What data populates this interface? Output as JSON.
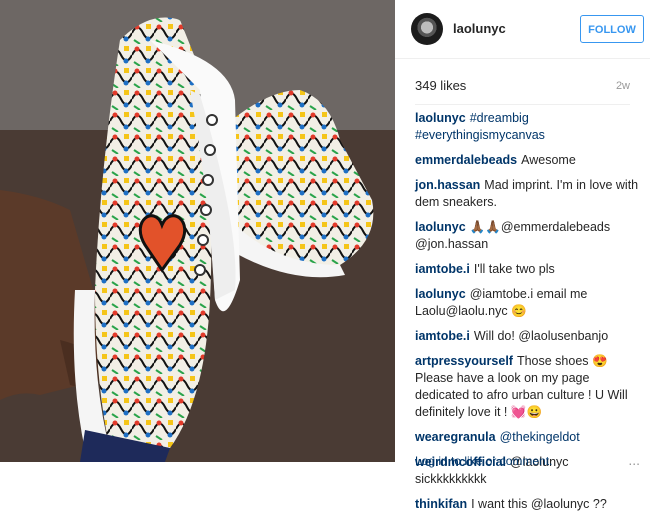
{
  "post": {
    "image_alt": "Hand-painted sneakers",
    "username": "laolunyc",
    "follow_label": "FOLLOW",
    "likes": "349 likes",
    "age": "2w"
  },
  "comments": [
    {
      "user": "laolunyc",
      "text": "#dreambig #everythingismycanvas"
    },
    {
      "user": "emmerdalebeads",
      "text": "Awesome"
    },
    {
      "user": "jon.hassan",
      "text": "Mad imprint. I'm in love with dem sneakers."
    },
    {
      "user": "laolunyc",
      "text": "🙏🏾🙏🏾@emmerdalebeads @jon.hassan"
    },
    {
      "user": "iamtobe.i",
      "text": "I'll take two pls"
    },
    {
      "user": "laolunyc",
      "text": "@iamtobe.i email me Laolu@laolu.nyc 😊"
    },
    {
      "user": "iamtobe.i",
      "text": "Will do! @laolusenbanjo"
    },
    {
      "user": "artpressyourself",
      "text": "Those shoes 😍 Please have a look on my page dedicated to afro urban culture ! U Will definitely love it ! 💓😀"
    },
    {
      "user": "wearegranula",
      "text": "@thekingeldot"
    },
    {
      "user": "weirdmcofficial",
      "text": "@laolunyc sickkkkkkkkk"
    },
    {
      "user": "thinkifan",
      "text": "I want this @laolunyc ??"
    }
  ],
  "footer": {
    "login_text": "Log in to like or comment.",
    "more_label": "..."
  }
}
